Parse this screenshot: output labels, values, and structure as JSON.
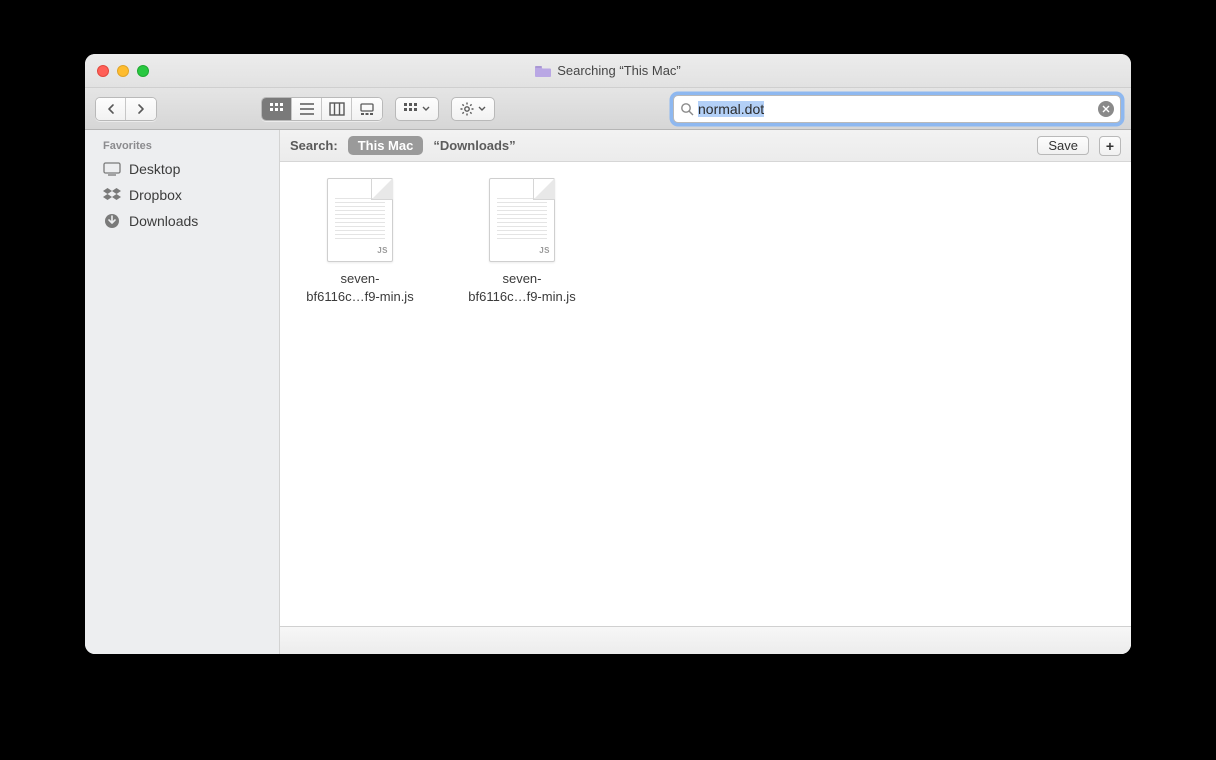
{
  "window": {
    "title": "Searching “This Mac”"
  },
  "search": {
    "value": "normal.dot"
  },
  "sidebar": {
    "header": "Favorites",
    "items": [
      {
        "icon": "desktop",
        "label": "Desktop"
      },
      {
        "icon": "dropbox",
        "label": "Dropbox"
      },
      {
        "icon": "downloads",
        "label": "Downloads"
      }
    ]
  },
  "scope": {
    "label": "Search:",
    "active": "This Mac",
    "alternate": "“Downloads”",
    "save_label": "Save"
  },
  "files": [
    {
      "name_line1": "seven-",
      "name_line2": "bf6116c…f9-min.js",
      "badge": "JS"
    },
    {
      "name_line1": "seven-",
      "name_line2": "bf6116c…f9-min.js",
      "badge": "JS"
    }
  ]
}
